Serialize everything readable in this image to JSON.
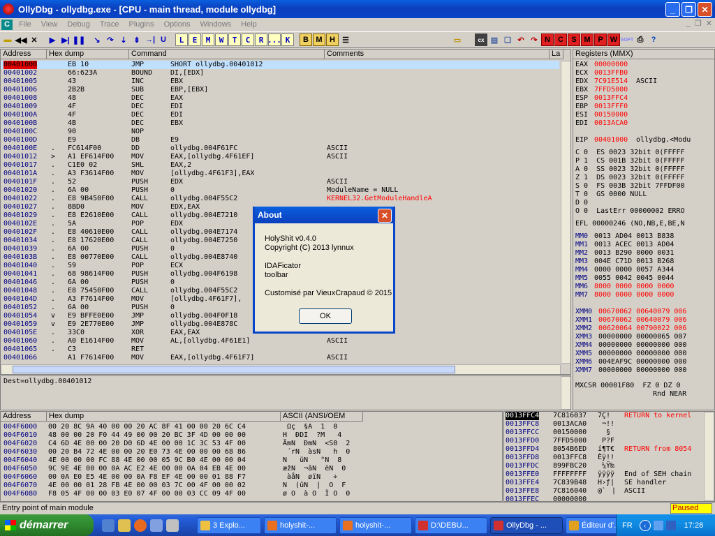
{
  "window": {
    "title": "OllyDbg - ollydbg.exe - [CPU - main thread, module ollydbg]"
  },
  "menu": [
    "File",
    "View",
    "Debug",
    "Trace",
    "Plugins",
    "Options",
    "Windows",
    "Help"
  ],
  "toolbar_letters": [
    "L",
    "E",
    "M",
    "W",
    "T",
    "C",
    "R",
    "...",
    "K",
    "B",
    "M",
    "H"
  ],
  "toolbar_right_letters": [
    "N",
    "C",
    "S",
    "M",
    "P",
    "W"
  ],
  "disasm": {
    "headers": [
      "Address",
      "Hex dump",
      "Command",
      "Comments",
      "La"
    ],
    "rows": [
      {
        "addr": "00401000",
        "mark": "",
        "hex": "EB 10",
        "op": "JMP",
        "arg": "SHORT ollydbg.00401012",
        "cmt": "",
        "sel": true
      },
      {
        "addr": "00401002",
        "mark": "",
        "hex": "66:623A",
        "op": "BOUND",
        "arg": "DI,[EDX]",
        "cmt": ""
      },
      {
        "addr": "00401005",
        "mark": "",
        "hex": "43",
        "op": "INC",
        "arg": "EBX",
        "cmt": ""
      },
      {
        "addr": "00401006",
        "mark": "",
        "hex": "2B2B",
        "op": "SUB",
        "arg": "EBP,[EBX]",
        "cmt": ""
      },
      {
        "addr": "00401008",
        "mark": "",
        "hex": "48",
        "op": "DEC",
        "arg": "EAX",
        "cmt": ""
      },
      {
        "addr": "00401009",
        "mark": "",
        "hex": "4F",
        "op": "DEC",
        "arg": "EDI",
        "cmt": ""
      },
      {
        "addr": "0040100A",
        "mark": "",
        "hex": "4F",
        "op": "DEC",
        "arg": "EDI",
        "cmt": ""
      },
      {
        "addr": "0040100B",
        "mark": "",
        "hex": "4B",
        "op": "DEC",
        "arg": "EBX",
        "cmt": ""
      },
      {
        "addr": "0040100C",
        "mark": "",
        "hex": "90",
        "op": "NOP",
        "arg": "",
        "cmt": ""
      },
      {
        "addr": "0040100D",
        "mark": "",
        "hex": "E9",
        "op": "DB",
        "arg": "E9",
        "cmt": ""
      },
      {
        "addr": "0040100E",
        "mark": ".",
        "hex": "FC614F00",
        "op": "DD",
        "arg": "ollydbg.004F61FC",
        "cmt": "ASCII"
      },
      {
        "addr": "00401012",
        "mark": ">",
        "hex": "A1 EF614F00",
        "op": "MOV",
        "arg": "EAX,[ollydbg.4F61EF]",
        "cmt": "ASCII"
      },
      {
        "addr": "00401017",
        "mark": ".",
        "hex": "C1E0 02",
        "op": "SHL",
        "arg": "EAX,2",
        "cmt": ""
      },
      {
        "addr": "0040101A",
        "mark": ".",
        "hex": "A3 F3614F00",
        "op": "MOV",
        "arg": "[ollydbg.4F61F3],EAX",
        "cmt": ""
      },
      {
        "addr": "0040101F",
        "mark": ".",
        "hex": "52",
        "op": "PUSH",
        "arg": "EDX",
        "cmt": "ASCII"
      },
      {
        "addr": "00401020",
        "mark": ".",
        "hex": "6A 00",
        "op": "PUSH",
        "arg": "0",
        "cmt": "ModuleName = NULL"
      },
      {
        "addr": "00401022",
        "mark": ".",
        "hex": "E8 9B450F00",
        "op": "CALL",
        "arg": "ollydbg.004F55C2",
        "cmt": "KERNEL32.GetModuleHandleA"
      },
      {
        "addr": "00401027",
        "mark": ".",
        "hex": "8BD0",
        "op": "MOV",
        "arg": "EDX,EAX",
        "cmt": ""
      },
      {
        "addr": "00401029",
        "mark": ".",
        "hex": "E8 E2610E00",
        "op": "CALL",
        "arg": "ollydbg.004E7210",
        "cmt": ""
      },
      {
        "addr": "0040102E",
        "mark": ".",
        "hex": "5A",
        "op": "POP",
        "arg": "EDX",
        "cmt": ""
      },
      {
        "addr": "0040102F",
        "mark": ".",
        "hex": "E8 40610E00",
        "op": "CALL",
        "arg": "ollydbg.004E7174",
        "cmt": ""
      },
      {
        "addr": "00401034",
        "mark": ".",
        "hex": "E8 17620E00",
        "op": "CALL",
        "arg": "ollydbg.004E7250",
        "cmt": ""
      },
      {
        "addr": "00401039",
        "mark": ".",
        "hex": "6A 00",
        "op": "PUSH",
        "arg": "0",
        "cmt": ""
      },
      {
        "addr": "0040103B",
        "mark": ".",
        "hex": "E8 00770E00",
        "op": "CALL",
        "arg": "ollydbg.004E8740",
        "cmt": ""
      },
      {
        "addr": "00401040",
        "mark": ".",
        "hex": "59",
        "op": "POP",
        "arg": "ECX",
        "cmt": ""
      },
      {
        "addr": "00401041",
        "mark": ".",
        "hex": "68 98614F00",
        "op": "PUSH",
        "arg": "ollydbg.004F6198",
        "cmt": ""
      },
      {
        "addr": "00401046",
        "mark": ".",
        "hex": "6A 00",
        "op": "PUSH",
        "arg": "0",
        "cmt": "NULL"
      },
      {
        "addr": "00401048",
        "mark": ".",
        "hex": "E8 75450F00",
        "op": "CALL",
        "arg": "ollydbg.004F55C2",
        "cmt": "oduleHandleA"
      },
      {
        "addr": "0040104D",
        "mark": ".",
        "hex": "A3 F7614F00",
        "op": "MOV",
        "arg": "[ollydbg.4F61F7],",
        "cmt": ""
      },
      {
        "addr": "00401052",
        "mark": ".",
        "hex": "6A 00",
        "op": "PUSH",
        "arg": "0",
        "cmt": ""
      },
      {
        "addr": "00401054",
        "mark": "v",
        "hex": "E9 BFFE0E00",
        "op": "JMP",
        "arg": "ollydbg.004F0F18",
        "cmt": ""
      },
      {
        "addr": "00401059",
        "mark": "v",
        "hex": "E9 2E770E00",
        "op": "JMP",
        "arg": "ollydbg.004E878C",
        "cmt": ""
      },
      {
        "addr": "0040105E",
        "mark": ".",
        "hex": "33C0",
        "op": "XOR",
        "arg": "EAX,EAX",
        "cmt": ""
      },
      {
        "addr": "00401060",
        "mark": ".",
        "hex": "A0 E1614F00",
        "op": "MOV",
        "arg": "AL,[ollydbg.4F61E1]",
        "cmt": "ASCII"
      },
      {
        "addr": "00401065",
        "mark": ".",
        "hex": "C3",
        "op": "RET",
        "arg": "",
        "cmt": ""
      },
      {
        "addr": "00401066",
        "mark": "",
        "hex": "A1 F7614F00",
        "op": "MOV",
        "arg": "EAX,[ollydbg.4F61F7]",
        "cmt": "ASCII"
      }
    ]
  },
  "info_line": "Dest=ollydbg.00401012",
  "registers": {
    "header": "Registers (MMX)",
    "gp": [
      {
        "n": "EAX",
        "v": "00000000",
        "c": ""
      },
      {
        "n": "ECX",
        "v": "0013FFB0",
        "c": ""
      },
      {
        "n": "EDX",
        "v": "7C91E514",
        "c": "ASCII"
      },
      {
        "n": "EBX",
        "v": "7FFD5000",
        "c": ""
      },
      {
        "n": "ESP",
        "v": "0013FFC4",
        "c": ""
      },
      {
        "n": "EBP",
        "v": "0013FFF0",
        "c": ""
      },
      {
        "n": "ESI",
        "v": "00150000",
        "c": ""
      },
      {
        "n": "EDI",
        "v": "0013ACA0",
        "c": ""
      }
    ],
    "eip": {
      "n": "EIP",
      "v": "00401000",
      "c": "ollydbg.<Modu"
    },
    "flags": [
      "C 0  ES 0023 32bit 0(FFFFF",
      "P 1  CS 001B 32bit 0(FFFFF",
      "A 0  SS 0023 32bit 0(FFFFF",
      "Z 1  DS 0023 32bit 0(FFFFF",
      "S 0  FS 003B 32bit 7FFDF00",
      "T 0  GS 0000 NULL",
      "D 0",
      "O 0  LastErr 00000002 ERRO"
    ],
    "efl": "EFL 00000246 (NO,NB,E,BE,N",
    "mm": [
      {
        "n": "MM0",
        "v": "0013 AD04 0013 B838",
        "red": false
      },
      {
        "n": "MM1",
        "v": "0013 ACEC 0013 AD04",
        "red": false
      },
      {
        "n": "MM2",
        "v": "0013 B290 0000 0031",
        "red": false
      },
      {
        "n": "MM3",
        "v": "004E C71D 0013 B268",
        "red": false
      },
      {
        "n": "MM4",
        "v": "0000 0000 0057 A344",
        "red": false
      },
      {
        "n": "MM5",
        "v": "0055 0042 0045 0044",
        "red": false
      },
      {
        "n": "MM6",
        "v": "8000 0000 0000 0000",
        "red": true
      },
      {
        "n": "MM7",
        "v": "8000 0000 0000 0000",
        "red": true
      }
    ],
    "xmm": [
      {
        "n": "XMM0",
        "v": "00670062 00640079 006"
      },
      {
        "n": "XMM1",
        "v": "00670062 00640079 006"
      },
      {
        "n": "XMM2",
        "v": "00620064 00790022 006"
      },
      {
        "n": "XMM3",
        "v": "00000000 00000065 007"
      },
      {
        "n": "XMM4",
        "v": "00000000 00000000 000"
      },
      {
        "n": "XMM5",
        "v": "00000000 00000000 000"
      },
      {
        "n": "XMM6",
        "v": "004EAF9C 00000000 000"
      },
      {
        "n": "XMM7",
        "v": "00000000 00000000 000"
      }
    ],
    "mxcsr": "MXCSR 00001F80  FZ 0 DZ 0",
    "rnd": "Rnd NEAR"
  },
  "dump": {
    "headers": [
      "Address",
      "Hex dump",
      "ASCII (ANSI/OEM"
    ],
    "rows": [
      {
        "a": "004F6000",
        "h": "00 20 8C 9A 40 00 00 20 AC 8F 41 00 00 20 6C C4",
        "s": " Ωç  §A  1  0"
      },
      {
        "a": "004F6010",
        "h": "48 00 00 20 F0 44 49 00 00 20 BC 3F 4D 00 00 00",
        "s": "H  ÐDI  ?M   4"
      },
      {
        "a": "004F6020",
        "h": "C4 6D 4E 00 00 20 D0 6D 4E 00 00 1C 3C 53 4F 00",
        "s": "ÄmN  ÐmN  <S0  2"
      },
      {
        "a": "004F6030",
        "h": "00 20 B4 72 4E 00 00 20 E0 73 4E 00 00 00 68 86",
        "s": " ´rN  àsN   h  0"
      },
      {
        "a": "004F6040",
        "h": "4E 00 00 00 FC 88 4E 00 00 05 9C B0 4E 00 00 04",
        "s": "N   üN   °N  8"
      },
      {
        "a": "004F6050",
        "h": "9C 9E 4E 00 00 0A AC E2 4E 00 00 0A 04 EB 4E 00",
        "s": "æžN  ¬âN  ëN  0"
      },
      {
        "a": "004F6060",
        "h": "00 0A E0 E5 4E 00 00 0A F8 EF 4E 00 00 01 88 F7",
        "s": " àåN  øïN   ÷"
      },
      {
        "a": "004F6070",
        "h": "4E 00 00 01 28 FB 4E 00 00 03 7C 00 4F 00 00 02",
        "s": "N  (ûN  |  O  F"
      },
      {
        "a": "004F6080",
        "h": "F8 05 4F 00 00 03 E0 07 4F 00 00 03 CC 09 4F 00",
        "s": "ø O  à O  Ì O  0"
      }
    ]
  },
  "stack": {
    "top_addr": "0013FFC4",
    "rows": [
      {
        "a": "0013FFC4",
        "v": "7C816037",
        "s": "7Ç!",
        "c": "RETURN to kernel",
        "red": true
      },
      {
        "a": "0013FFC8",
        "v": "0013ACA0",
        "s": " ¬!!",
        "c": "",
        "red": false
      },
      {
        "a": "0013FFCC",
        "v": "00150000",
        "s": "  §",
        "c": "",
        "red": false
      },
      {
        "a": "0013FFD0",
        "v": "7FFD5000",
        "s": " P?F",
        "c": "",
        "red": false
      },
      {
        "a": "0013FFD4",
        "v": "8054B6ED",
        "s": "í¶T€",
        "c": "RETURN from 8054",
        "red": true
      },
      {
        "a": "0013FFD8",
        "v": "0013FFC8",
        "s": "Èÿ!!",
        "c": "",
        "red": false
      },
      {
        "a": "0013FFDC",
        "v": "899FBC20",
        "s": " ¼Ÿ‰",
        "c": "",
        "red": false
      },
      {
        "a": "0013FFE0",
        "v": "FFFFFFFF",
        "s": "ÿÿÿÿ",
        "c": "End of SEH chain",
        "red": false
      },
      {
        "a": "0013FFE4",
        "v": "7C839B48",
        "s": "H›ƒ|",
        "c": "SE handler",
        "red": false
      },
      {
        "a": "0013FFE8",
        "v": "7C816040",
        "s": "@`|",
        "c": "ASCII",
        "red": false
      },
      {
        "a": "0013FFEC",
        "v": "00000000",
        "s": "",
        "c": "",
        "red": false
      }
    ]
  },
  "dialog": {
    "title": "About",
    "line1": "HolyShit v0.4.0",
    "line2": "Copyright (C) 2013 lynnux",
    "line3": "IDAFicator",
    "line4": "toolbar",
    "line5": "Customisé par VieuxCrapaud © 2015",
    "ok": "OK"
  },
  "status": {
    "text": "Entry point of main module",
    "state": "Paused"
  },
  "taskbar": {
    "start": "démarrer",
    "tasks": [
      {
        "label": "3 Explo...",
        "color": "#f0c040"
      },
      {
        "label": "holyshit-...",
        "color": "#e87020"
      },
      {
        "label": "holyshit-...",
        "color": "#e87020"
      },
      {
        "label": "D:\\DEBU...",
        "color": "#d03030"
      },
      {
        "label": "OllyDbg - ...",
        "color": "#d03030"
      },
      {
        "label": "Éditeur d'...",
        "color": "#e0a020"
      }
    ],
    "lang": "FR",
    "clock": "17:28"
  }
}
